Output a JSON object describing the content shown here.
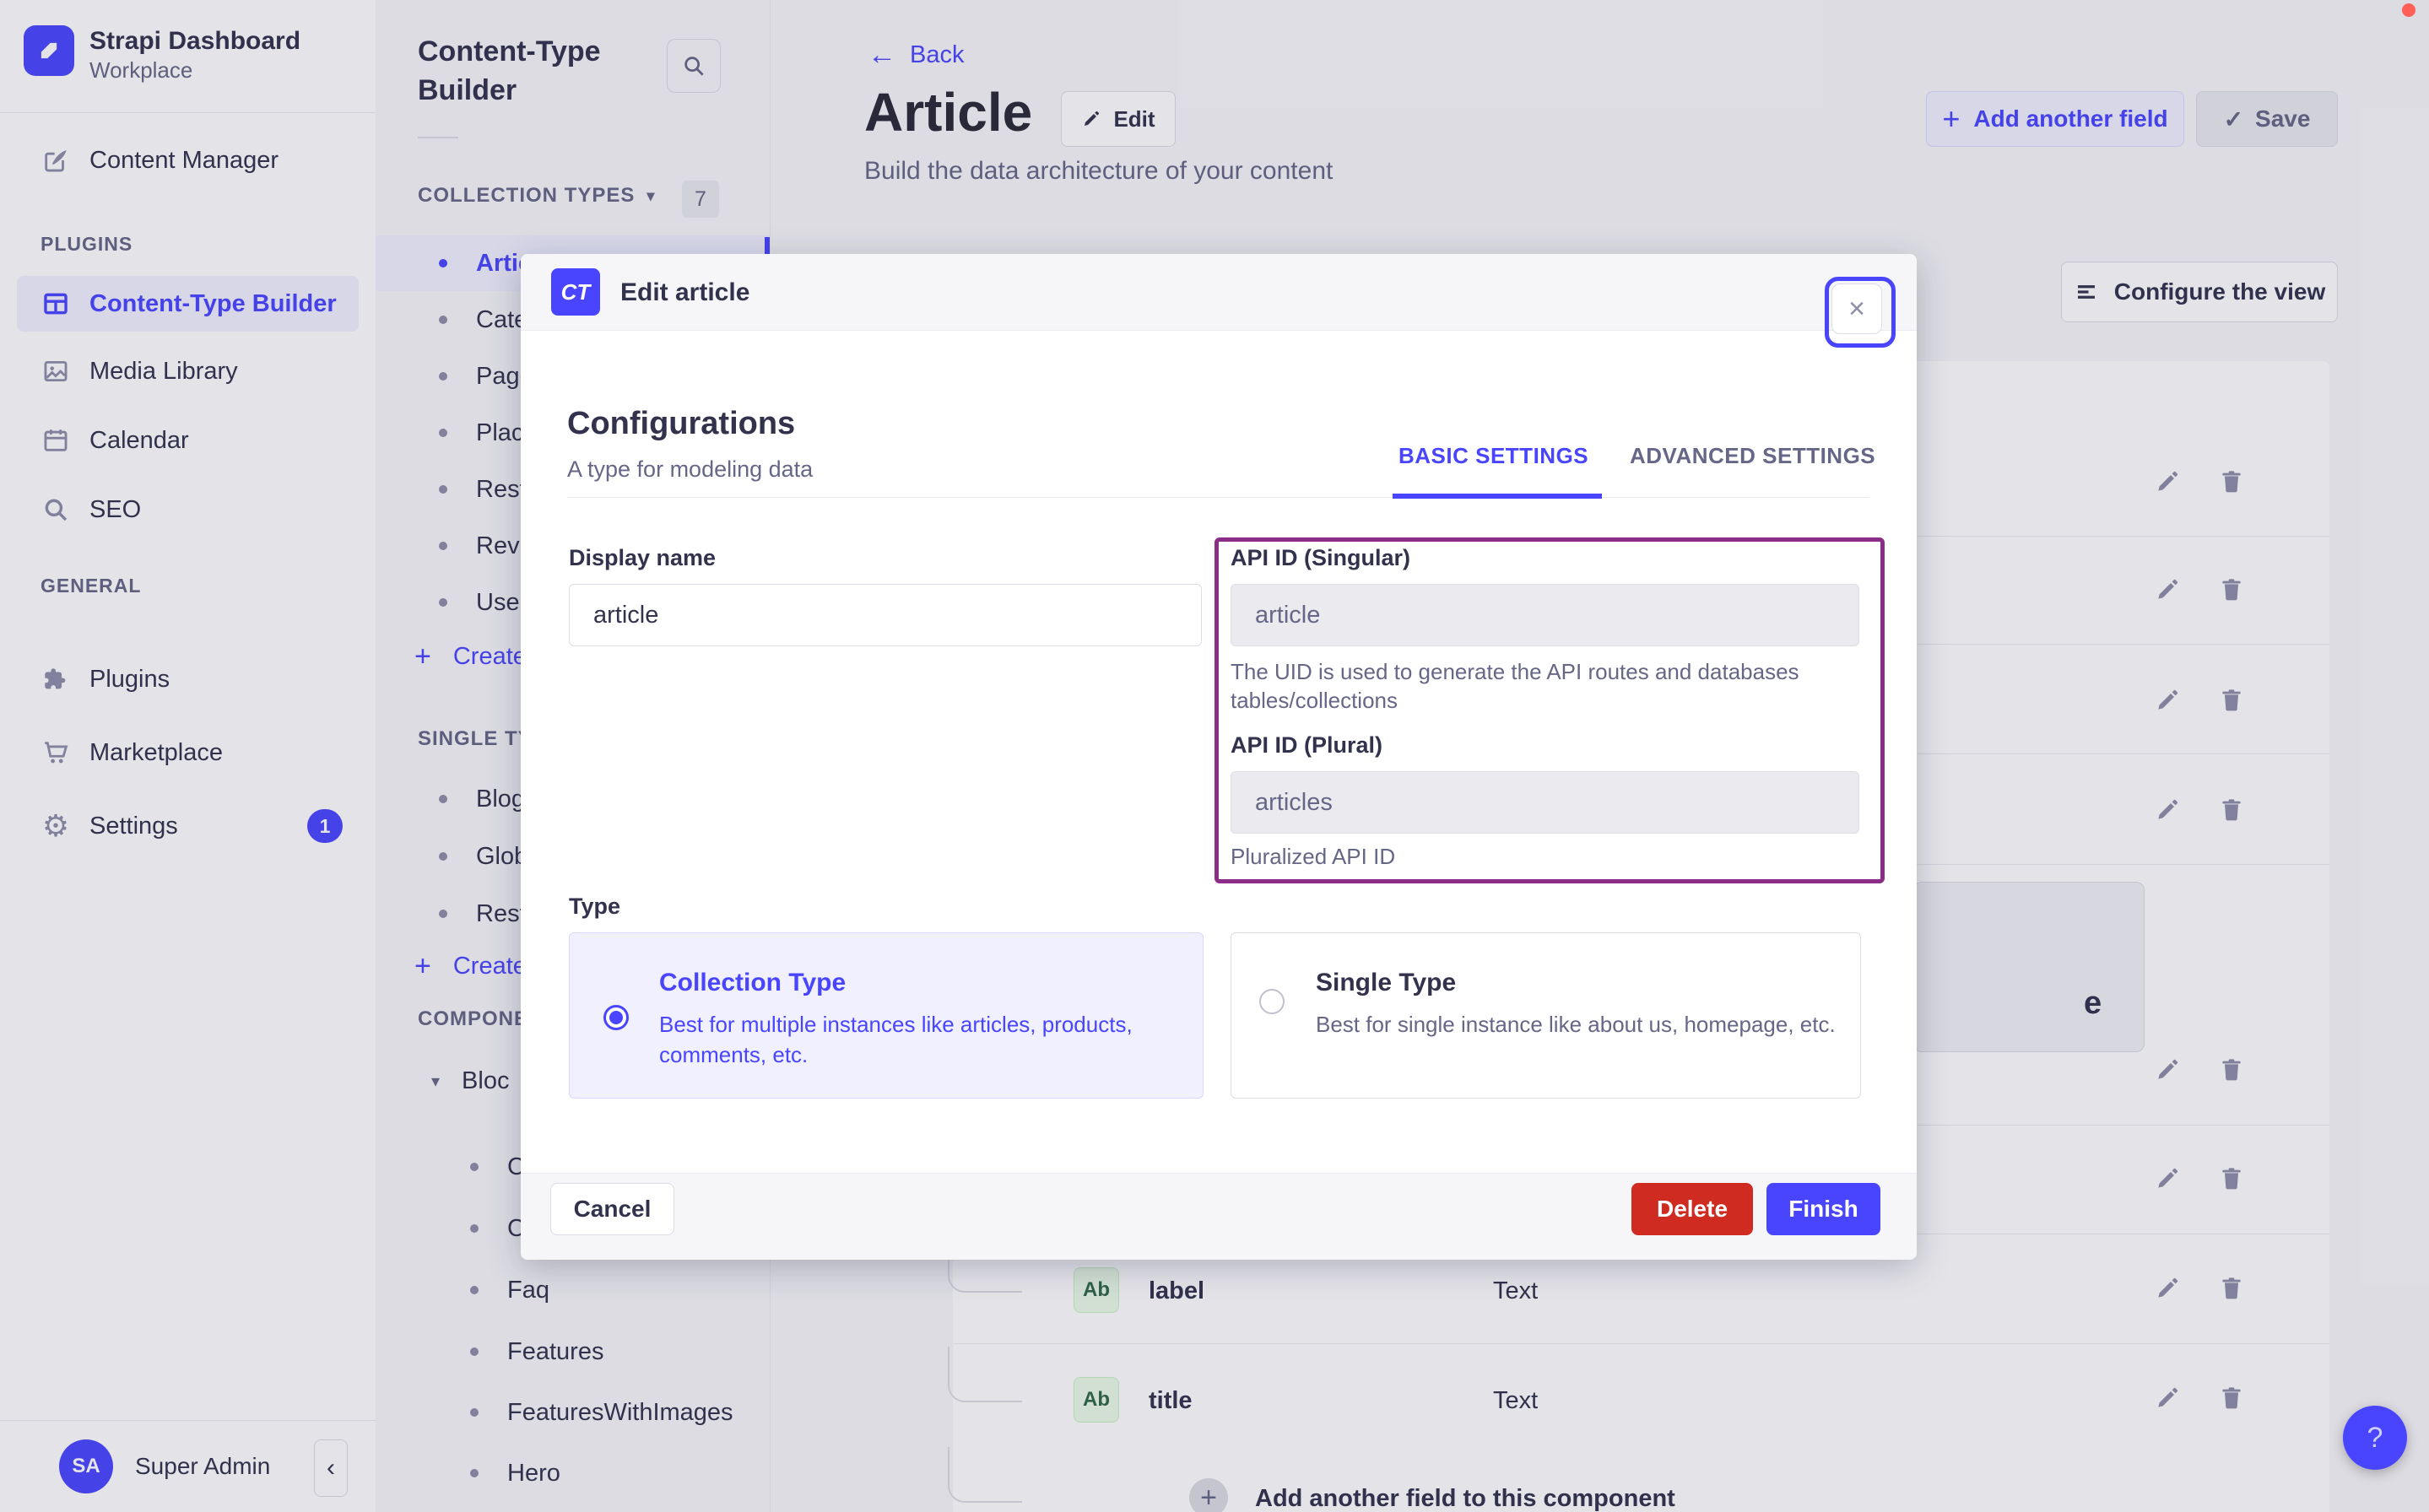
{
  "colors": {
    "accent": "#4945ff",
    "danger": "#d02b20",
    "annotation_border": "#8b2d87",
    "badge_green_bg": "#eafbe7",
    "badge_green_text": "#2f6846"
  },
  "nav": {
    "app_title": "Strapi Dashboard",
    "app_subtitle": "Workplace",
    "content_manager": "Content Manager",
    "plugins_header": "PLUGINS",
    "plugins_items": [
      {
        "label": "Content-Type Builder"
      },
      {
        "label": "Media Library"
      },
      {
        "label": "Calendar"
      },
      {
        "label": "SEO"
      }
    ],
    "general_header": "GENERAL",
    "general_items": [
      {
        "label": "Plugins"
      },
      {
        "label": "Marketplace"
      },
      {
        "label": "Settings",
        "badge": "1"
      }
    ],
    "user": {
      "initials": "SA",
      "name": "Super Admin"
    },
    "collapse_glyph": "‹"
  },
  "subnav": {
    "title": "Content-Type Builder",
    "collection": {
      "header": "COLLECTION TYPES",
      "caret": "▾",
      "count": "7",
      "items": [
        {
          "label": "Artic"
        },
        {
          "label": "Cate"
        },
        {
          "label": "Page"
        },
        {
          "label": "Plac"
        },
        {
          "label": "Rest"
        },
        {
          "label": "Revi"
        },
        {
          "label": "User"
        }
      ],
      "create_label": "Create",
      "plus": "+"
    },
    "single": {
      "header": "SINGLE TY",
      "items": [
        {
          "label": "Blog"
        },
        {
          "label": "Glob"
        },
        {
          "label": "Rest"
        }
      ],
      "create_label": "Create",
      "plus": "+"
    },
    "components": {
      "header": "COMPONE",
      "group_label": "Bloc",
      "group_caret": "▾",
      "items": [
        {
          "label": "Ct"
        },
        {
          "label": "Ct"
        },
        {
          "label": "Faq"
        },
        {
          "label": "Features"
        },
        {
          "label": "FeaturesWithImages"
        },
        {
          "label": "Hero"
        }
      ]
    }
  },
  "main": {
    "back_label": "Back",
    "back_arrow": "←",
    "title": "Article",
    "edit_label": "Edit",
    "subtitle": "Build the data architecture of your content",
    "add_field_label": "Add another field",
    "add_field_plus": "+",
    "save_label": "Save",
    "save_check": "✓",
    "configure_label": "Configure the view",
    "fields": [
      {
        "badge": "Ab",
        "name": "label",
        "type": "Text"
      },
      {
        "badge": "Ab",
        "name": "title",
        "type": "Text"
      }
    ],
    "add_component_field_label": "Add another field to this component",
    "add_component_plus": "+",
    "partial_text": "e",
    "help_label": "?"
  },
  "modal": {
    "badge": "CT",
    "title": "Edit article",
    "close_glyph": "×",
    "heading": "Configurations",
    "subheading": "A type for modeling data",
    "tab_basic": "BASIC SETTINGS",
    "tab_advanced": "ADVANCED SETTINGS",
    "display_name": {
      "label": "Display name",
      "value": "article"
    },
    "api_singular": {
      "label": "API ID (Singular)",
      "value": "article",
      "help": "The UID is used to generate the API routes and databases tables/collections"
    },
    "api_plural": {
      "label": "API ID (Plural)",
      "value": "articles",
      "help": "Pluralized API ID"
    },
    "type_label": "Type",
    "collection_card": {
      "title": "Collection Type",
      "desc": "Best for multiple instances like articles, products, comments, etc."
    },
    "single_card": {
      "title": "Single Type",
      "desc": "Best for single instance like about us, homepage, etc."
    },
    "cancel_label": "Cancel",
    "delete_label": "Delete",
    "finish_label": "Finish"
  }
}
